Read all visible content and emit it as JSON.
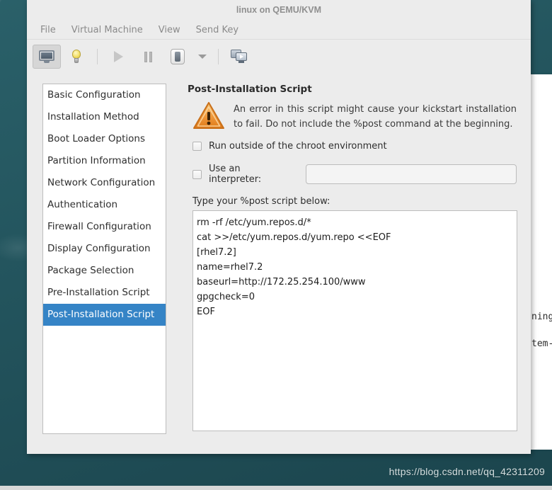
{
  "window": {
    "title": "linux on QEMU/KVM",
    "menus": [
      {
        "label": "File"
      },
      {
        "label": "Virtual Machine"
      },
      {
        "label": "View"
      },
      {
        "label": "Send Key"
      }
    ],
    "toolbar": [
      {
        "name": "show-console-button",
        "icon": "monitor-icon",
        "active": true
      },
      {
        "name": "show-details-button",
        "icon": "lightbulb-icon",
        "active": false
      },
      {
        "name": "run-button",
        "icon": "play-icon",
        "active": false
      },
      {
        "name": "pause-button",
        "icon": "pause-icon",
        "active": false
      },
      {
        "name": "shutdown-button",
        "icon": "power-icon",
        "active": false
      },
      {
        "name": "shutdown-menu-button",
        "icon": "chevron-down-icon",
        "active": false
      },
      {
        "name": "snapshots-button",
        "icon": "screens-icon",
        "active": false
      }
    ]
  },
  "dialog": {
    "sidebar": [
      {
        "label": "Basic Configuration",
        "selected": false
      },
      {
        "label": "Installation Method",
        "selected": false
      },
      {
        "label": "Boot Loader Options",
        "selected": false
      },
      {
        "label": "Partition Information",
        "selected": false
      },
      {
        "label": "Network Configuration",
        "selected": false
      },
      {
        "label": "Authentication",
        "selected": false
      },
      {
        "label": "Firewall Configuration",
        "selected": false
      },
      {
        "label": "Display Configuration",
        "selected": false
      },
      {
        "label": "Package Selection",
        "selected": false
      },
      {
        "label": "Pre-Installation Script",
        "selected": false
      },
      {
        "label": "Post-Installation Script",
        "selected": true
      }
    ],
    "panel": {
      "title": "Post-Installation Script",
      "warning_text": "An error in this script might cause your kickstart installation to fail. Do not include the %post command at the beginning.",
      "chroot_checkbox_label": "Run outside of the chroot environment",
      "chroot_checked": false,
      "interpreter_checkbox_label": "Use an interpreter:",
      "interpreter_checked": false,
      "interpreter_value": "",
      "interpreter_placeholder": "",
      "script_label": "Type your %post script below:",
      "script_lines": [
        "rm -rf /etc/yum.repos.d/*",
        "cat >>/etc/yum.repos.d/yum.repo <<EOF",
        "[rhel7.2]",
        "name=rhel7.2",
        "baseurl=http://172.25.254.100/www",
        "gpgcheck=0",
        "EOF"
      ]
    }
  },
  "background_window": {
    "lines": [
      "ning",
      "tem-"
    ]
  },
  "desktop": {
    "watermark": "https://blog.csdn.net/qq_42311209"
  },
  "colors": {
    "selection_blue": "#3584c6",
    "window_chrome": "#ececec",
    "desktop_teal": "#24565f",
    "warning_orange": "#e8903a"
  }
}
